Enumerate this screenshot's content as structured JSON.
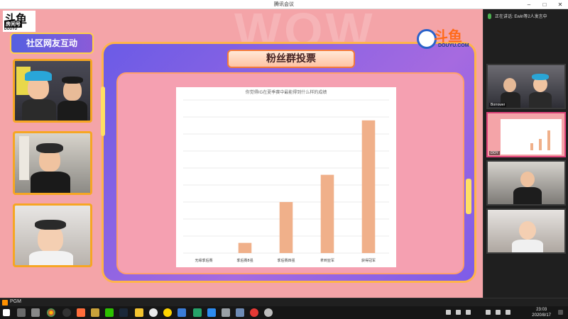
{
  "window": {
    "title": "腾讯会议"
  },
  "stream": {
    "logo_big": "斗鱼",
    "logo_sub": "房间号",
    "logo_en": "DOUYU",
    "community_banner": "社区网友互动",
    "poll_title": "粉丝群投票",
    "brand_text": "斗鱼",
    "brand_url": "DOUYU.COM",
    "bg_word": "WOW"
  },
  "chart_data": {
    "type": "bar",
    "title": "你觉得IG在夏季赛中最能得到什么样的成绩",
    "categories": [
      "无缘季后赛",
      "季后赛8强",
      "季后赛四强",
      "拿到亚军",
      "获得冠军"
    ],
    "values": [
      0,
      3,
      15,
      23,
      39
    ],
    "ylim": [
      0,
      45
    ],
    "grid": true,
    "bar_color": "#f0b08a"
  },
  "sidebar": {
    "header_text": "正在讲话: Ewin等2人发言中",
    "tiles": [
      {
        "label": "Borrower",
        "active": false
      },
      {
        "label": "DOY",
        "active": true
      },
      {
        "label": "",
        "active": false
      },
      {
        "label": "",
        "active": false
      }
    ]
  },
  "statusline": {
    "text": "PGM"
  },
  "taskbar": {
    "time": "23:03",
    "date": "2020/8/17"
  }
}
